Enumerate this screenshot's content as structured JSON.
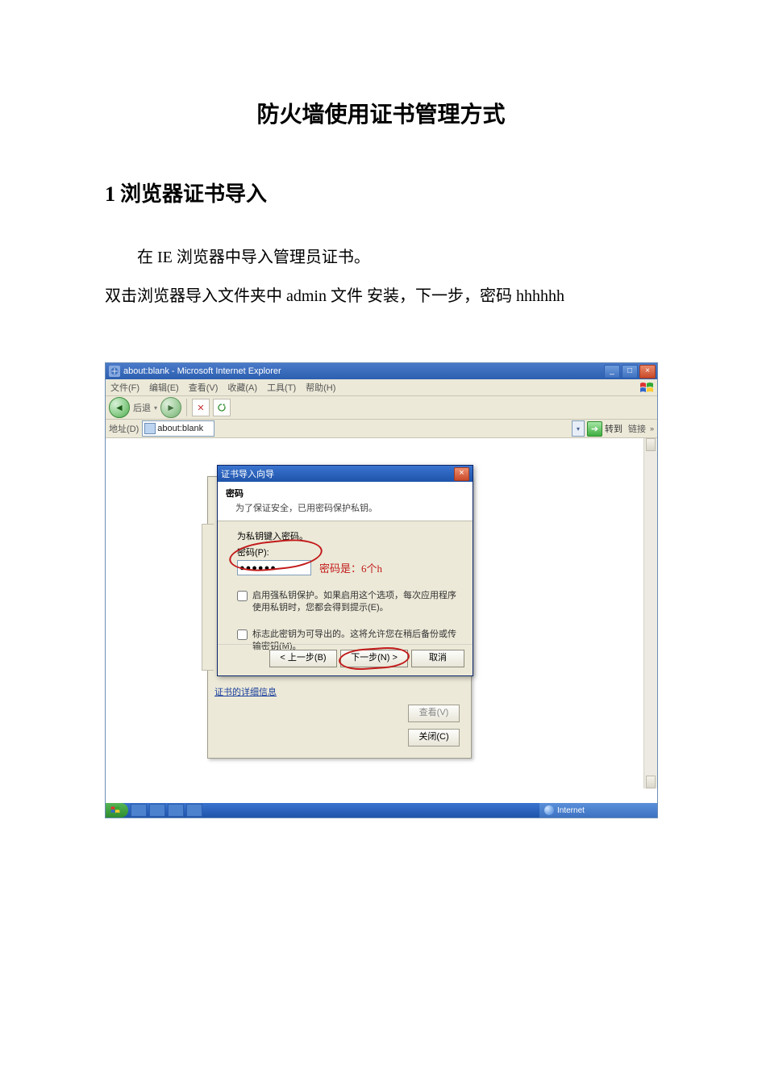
{
  "doc": {
    "title": "防火墙使用证书管理方式",
    "section_number": "1",
    "section_title": "浏览器证书导入",
    "para1": "在 IE 浏览器中导入管理员证书。",
    "para2": "双击浏览器导入文件夹中 admin 文件 安装，下一步，密码 hhhhhh"
  },
  "ie": {
    "titlebar": "about:blank - Microsoft Internet Explorer",
    "menus": {
      "file": "文件(F)",
      "edit": "编辑(E)",
      "view": "查看(V)",
      "fav": "收藏(A)",
      "tools": "工具(T)",
      "help": "帮助(H)"
    },
    "toolbar": {
      "back": "后退"
    },
    "address_label": "地址(D)",
    "address_value": "about:blank",
    "go_label": "转到",
    "links_label": "链接",
    "tray_label": "Internet"
  },
  "wizard_back": {
    "link": "证书的详细信息",
    "view_btn": "查看(V)",
    "close_btn": "关闭(C)"
  },
  "wizard": {
    "title": "证书导入向导",
    "head_bold": "密码",
    "head_sub": "为了保证安全，已用密码保护私钥。",
    "body_prompt": "为私钥键入密码。",
    "pw_label": "密码(P):",
    "pw_value": "●●●●●●",
    "pw_annot": "密码是：6个h",
    "chk1": "启用强私钥保护。如果启用这个选项，每次应用程序使用私钥时，您都会得到提示(E)。",
    "chk2": "标志此密钥为可导出的。这将允许您在稍后备份或传输密钥(M)。",
    "btn_back": "< 上一步(B)",
    "btn_next": "下一步(N) >",
    "btn_cancel": "取消"
  }
}
